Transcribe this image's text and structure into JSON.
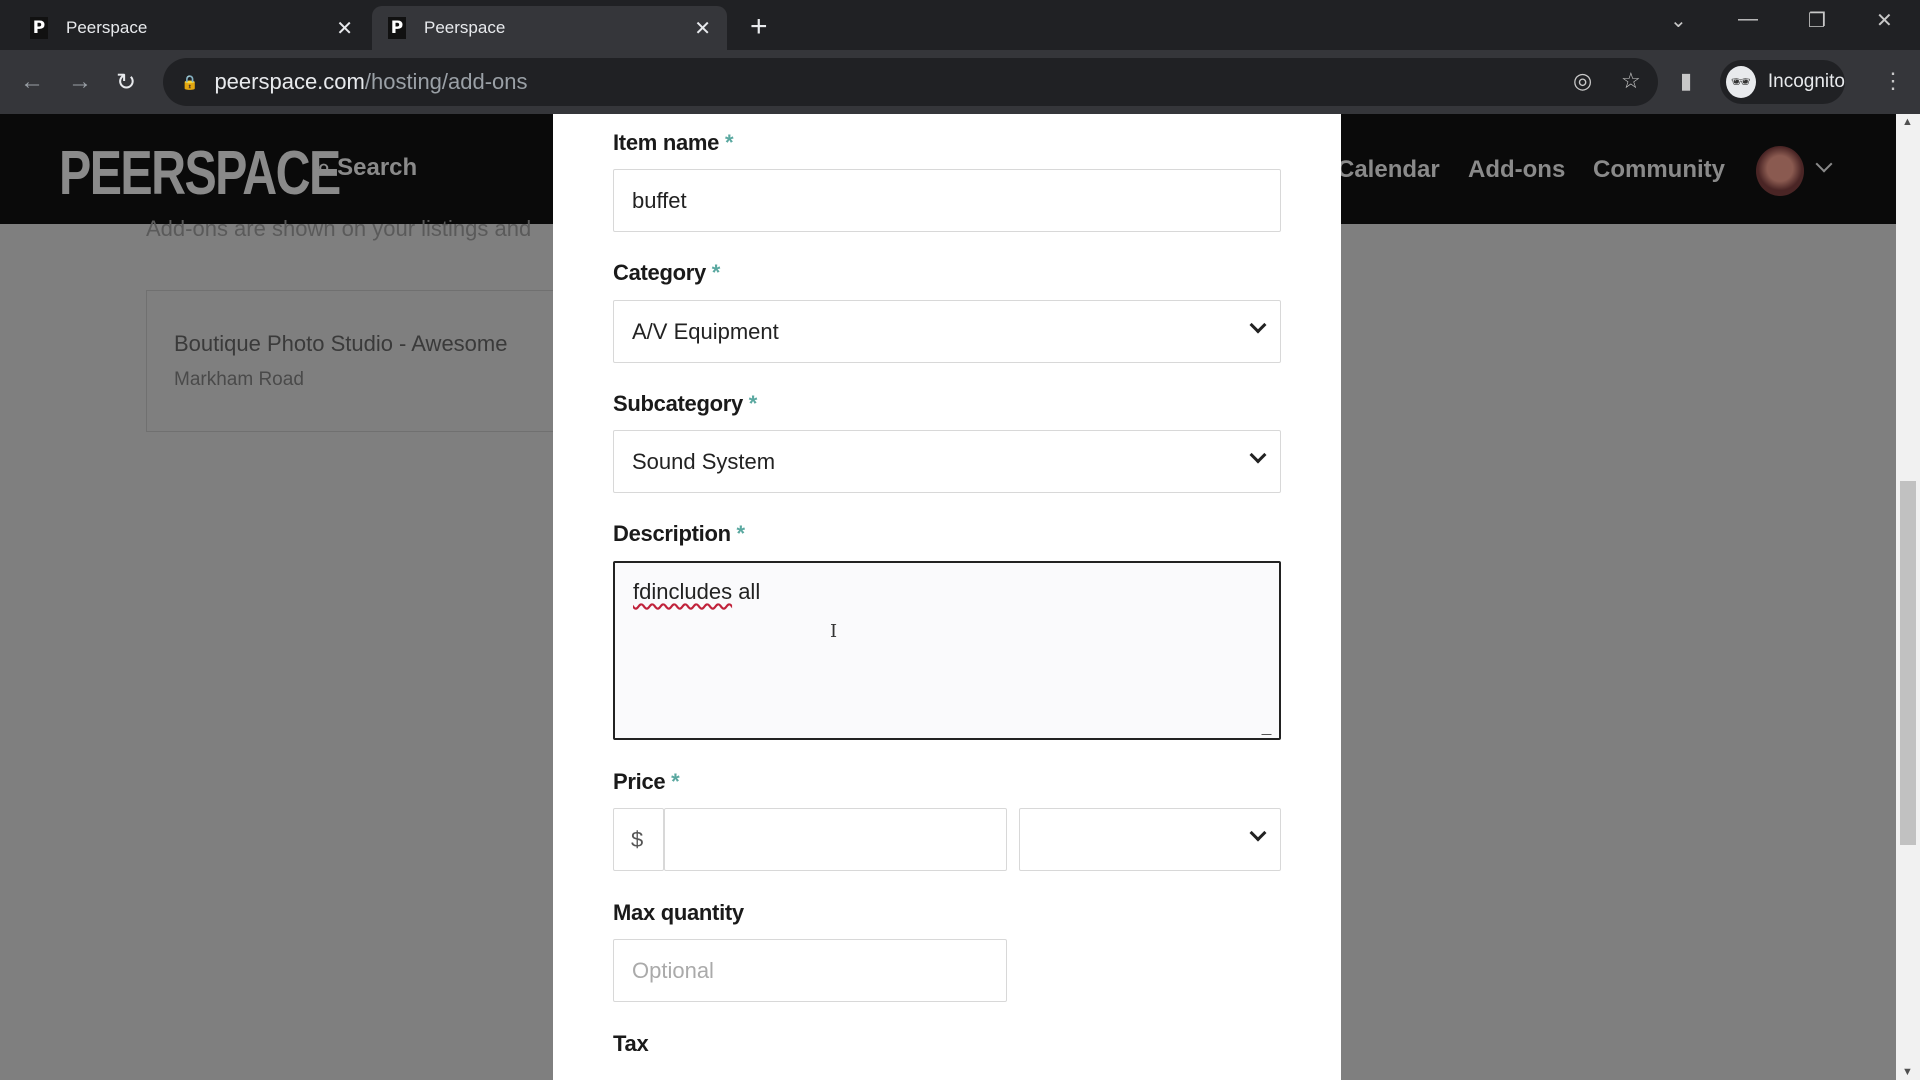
{
  "browser": {
    "tabs": [
      {
        "title": "Peerspace",
        "favicon": "P"
      },
      {
        "title": "Peerspace",
        "favicon": "P"
      }
    ],
    "url_host": "peerspace.com",
    "url_path": "/hosting/add-ons",
    "profile": "Incognito"
  },
  "header": {
    "logo": "PEERSPACE",
    "search": "Search",
    "nav": [
      "Calendar",
      "Add-ons",
      "Community"
    ]
  },
  "page": {
    "subtitle": "Add-ons are shown on your listings and",
    "listing": {
      "title": "Boutique Photo Studio - Awesome",
      "subtitle": "Markham Road"
    }
  },
  "form": {
    "item_name": {
      "label": "Item name",
      "required": "*",
      "value": "buffet"
    },
    "category": {
      "label": "Category",
      "required": "*",
      "value": "A/V Equipment"
    },
    "subcategory": {
      "label": "Subcategory",
      "required": "*",
      "value": "Sound System"
    },
    "description": {
      "label": "Description",
      "required": "*",
      "value_misspelled": "fdincludes",
      "value_rest": " all"
    },
    "price": {
      "label": "Price",
      "required": "*",
      "currency": "$",
      "value": "",
      "unit": ""
    },
    "max_quantity": {
      "label": "Max quantity",
      "placeholder": "Optional"
    },
    "tax": {
      "label": "Tax"
    }
  },
  "colors": {
    "accent": "#5aa8a0",
    "header": "#0a0a0a",
    "overlay": "#7f7f7f"
  }
}
